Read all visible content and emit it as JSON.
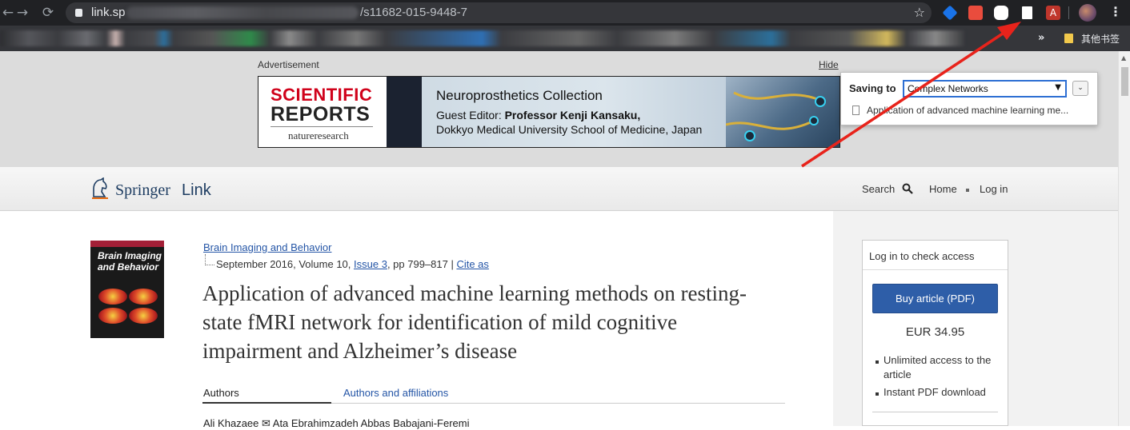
{
  "browser": {
    "url_host": "link.sp",
    "url_tail": "/s11682-015-9448-7",
    "bookmarks_more": "»",
    "bookmarks_other": "其他书签",
    "nav": {
      "back": "←",
      "forward": "→",
      "reload": "⟳",
      "star": "☆",
      "menu": "⋮"
    }
  },
  "ad": {
    "label": "Advertisement",
    "hide": "Hide",
    "brand_line1": "SCIENTIFIC",
    "brand_line2": "REPORTS",
    "brand_sub": "natureresearch",
    "title": "Neuroprosthetics Collection",
    "editor_prefix": "Guest Editor: ",
    "editor_name": "Professor Kenji Kansaku,",
    "affiliation": "Dokkyo Medical University School of Medicine, Japan"
  },
  "popup": {
    "label": "Saving to",
    "selected": "Complex Networks",
    "arrow": "▼",
    "button": "⌄",
    "item": "Application of advanced machine learning me..."
  },
  "header": {
    "brand_name": "Springer",
    "brand_link": "Link",
    "search": "Search",
    "home": "Home",
    "login": "Log in"
  },
  "article": {
    "cover_title": "Brain Imaging and Behavior",
    "journal": "Brain Imaging and Behavior",
    "date_vol": "September 2016, Volume 10, ",
    "issue": "Issue 3",
    "pages": ", pp 799–817 | ",
    "cite": "Cite as",
    "title": "Application of advanced machine learning methods on resting-state fMRI network for identification of mild cognitive impairment and Alzheimer’s disease",
    "tab_authors": "Authors",
    "tab_affiliations": "Authors and affiliations",
    "authors_line": "Ali Khazaee  ✉  Ata Ebrahimzadeh  Abbas Babajani-Feremi"
  },
  "sidebar": {
    "access": "Log in to check access",
    "buy": "Buy article (PDF)",
    "price": "EUR 34.95",
    "features": [
      "Unlimited access to the article",
      "Instant PDF download"
    ]
  },
  "colors": {
    "annotation_arrow": "#e8231b",
    "link": "#2455a6",
    "buy_button": "#2e5ea8"
  }
}
